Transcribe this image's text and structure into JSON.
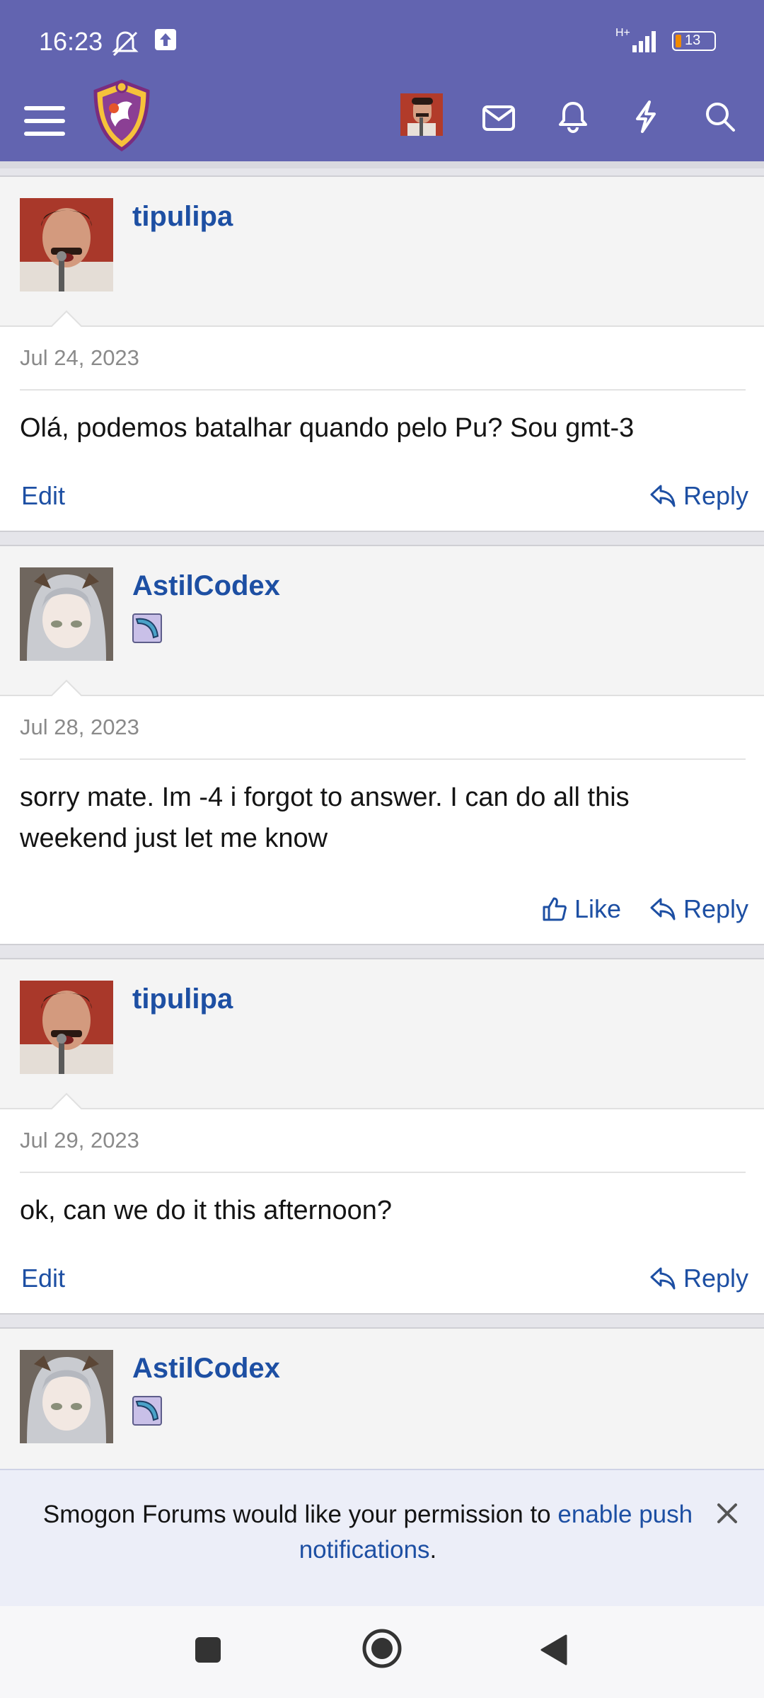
{
  "status_bar": {
    "time": "16:23",
    "battery": "13",
    "network": "H+"
  },
  "nav": {
    "items": [
      "menu",
      "logo",
      "avatar",
      "inbox",
      "alerts",
      "whats-new",
      "search"
    ]
  },
  "posts": [
    {
      "username": "tipulipa",
      "date": "Jul 24, 2023",
      "body": "Olá, podemos batalhar quando pelo Pu? Sou gmt-3",
      "actions": {
        "edit": "Edit",
        "reply": "Reply"
      }
    },
    {
      "username": "AstilCodex",
      "date": "Jul 28, 2023",
      "body": "sorry mate. Im -4 i forgot to answer. I can do all this weekend just let me know",
      "actions": {
        "like": "Like",
        "reply": "Reply"
      }
    },
    {
      "username": "tipulipa",
      "date": "Jul 29, 2023",
      "body": "ok, can we do it this afternoon?",
      "actions": {
        "edit": "Edit",
        "reply": "Reply"
      }
    },
    {
      "username": "AstilCodex"
    }
  ],
  "push_banner": {
    "text": "Smogon Forums would like your permission to",
    "link": "enable push notifications",
    "suffix": "."
  },
  "colors": {
    "header": "#6264b0",
    "link": "#1d4fa3"
  }
}
